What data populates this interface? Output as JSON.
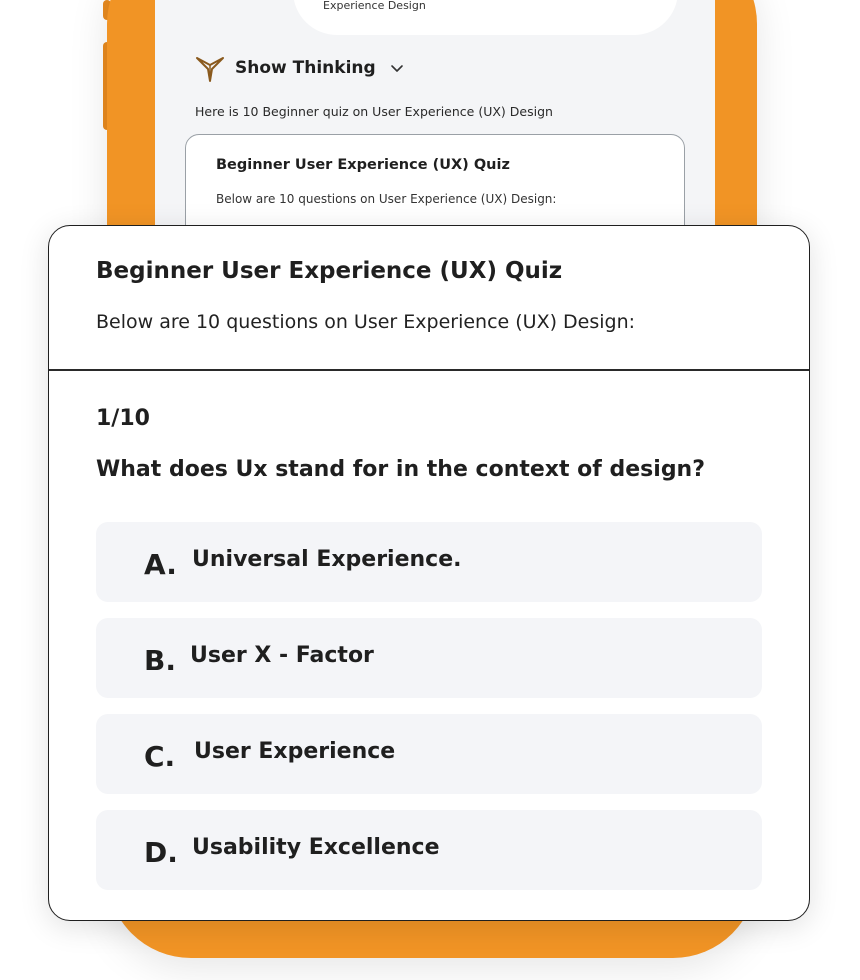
{
  "background_chat": {
    "user_message_snippet": "Experience Design",
    "show_thinking_label": "Show Thinking",
    "intro_text": "Here is 10 Beginner quiz on User Experience (UX) Design",
    "card_title": "Beginner User Experience (UX) Quiz",
    "card_subtitle": "Below are 10 questions on User Experience (UX) Design:"
  },
  "quiz": {
    "title": "Beginner User Experience (UX) Quiz",
    "subtitle": "Below are 10 questions on User Experience (UX) Design:",
    "progress": "1/10",
    "question": "What does Ux stand for in the context of design?",
    "options": [
      {
        "letter": "A.",
        "text": "Universal Experience."
      },
      {
        "letter": "B.",
        "text": "User X - Factor"
      },
      {
        "letter": "C.",
        "text": "User Experience"
      },
      {
        "letter": "D.",
        "text": "Usability Excellence"
      }
    ]
  },
  "colors": {
    "phone_frame": "#f19425",
    "option_bg": "#f4f5f8",
    "logo": "#8a5a1e"
  }
}
